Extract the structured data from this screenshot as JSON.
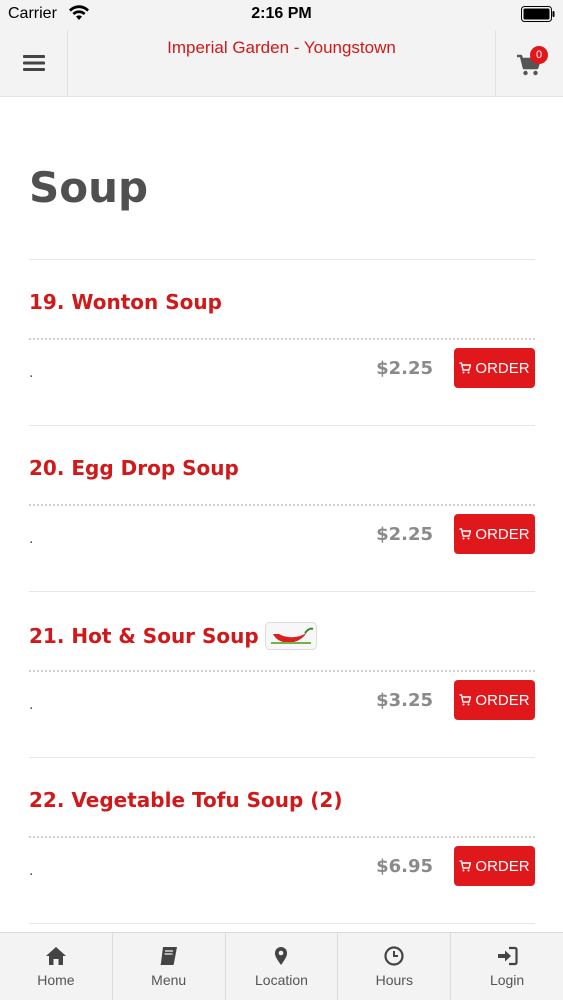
{
  "status_bar": {
    "carrier": "Carrier",
    "time": "2:16 PM"
  },
  "header": {
    "title": "Imperial Garden - Youngstown",
    "cart_count": "0"
  },
  "category": {
    "title": "Soup"
  },
  "items": [
    {
      "name": "19. Wonton Soup",
      "description": ".",
      "price": "$2.25",
      "order_label": "ORDER",
      "spicy": false
    },
    {
      "name": "20. Egg Drop Soup",
      "description": ".",
      "price": "$2.25",
      "order_label": "ORDER",
      "spicy": false
    },
    {
      "name": "21. Hot & Sour Soup",
      "description": ".",
      "price": "$3.25",
      "order_label": "ORDER",
      "spicy": true
    },
    {
      "name": "22. Vegetable Tofu Soup (2)",
      "description": ".",
      "price": "$6.95",
      "order_label": "ORDER",
      "spicy": false
    }
  ],
  "tabs": [
    {
      "label": "Home",
      "icon": "home-icon"
    },
    {
      "label": "Menu",
      "icon": "book-icon"
    },
    {
      "label": "Location",
      "icon": "map-pin-icon"
    },
    {
      "label": "Hours",
      "icon": "clock-icon"
    },
    {
      "label": "Login",
      "icon": "login-icon"
    }
  ],
  "colors": {
    "brand_red": "#d0191a",
    "button_red": "#e0171b",
    "price_gray": "#8a8a8a",
    "title_gray": "#505050"
  }
}
